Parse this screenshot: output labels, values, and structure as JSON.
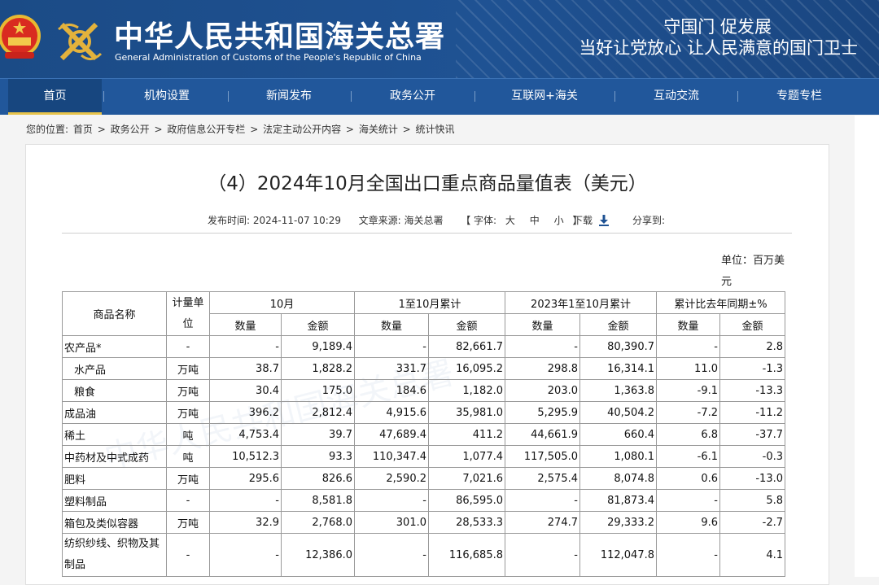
{
  "header": {
    "title_cn": "中华人民共和国海关总署",
    "title_en": "General Administration of Customs of the People's Republic of China",
    "slogan_line1": "守国门  促发展",
    "slogan_line2": "当好让党放心  让人民满意的国门卫士",
    "emblem_icon": "national-emblem-icon",
    "logo_icon": "customs-emblem-icon"
  },
  "nav": {
    "items": [
      {
        "label": "首页"
      },
      {
        "label": "机构设置"
      },
      {
        "label": "新闻发布"
      },
      {
        "label": "政务公开"
      },
      {
        "label": "互联网+海关"
      },
      {
        "label": "互动交流"
      },
      {
        "label": "专题专栏"
      }
    ]
  },
  "breadcrumb": {
    "prefix": "您的位置:",
    "items": [
      "首页",
      "政务公开",
      "政府信息公开专栏",
      "法定主动公开内容",
      "海关统计",
      "统计快讯"
    ],
    "separator": ">"
  },
  "article": {
    "title": "（4）2024年10月全国出口重点商品量值表（美元）",
    "publish_label": "发布时间:",
    "publish_time": "2024-11-07 10:29",
    "source_label": "文章来源:",
    "source": "海关总署",
    "font_open": "【 字体:",
    "font_large": "大",
    "font_medium": "中",
    "font_small": "小",
    "font_close": "】",
    "download_label": "下载",
    "share_label": "分享到:",
    "unit_text": "单位：百万美元"
  },
  "table": {
    "headers": {
      "name": "商品名称",
      "unit": "计量单位",
      "group1": "10月",
      "group2": "1至10月累计",
      "group3": "2023年1至10月累计",
      "group4": "累计比去年同期±%",
      "qty": "数量",
      "amt": "金额"
    },
    "rows": [
      {
        "name": "农产品*",
        "indent": false,
        "unit": "-",
        "c1": "-",
        "c2": "9,189.4",
        "c3": "-",
        "c4": "82,661.7",
        "c5": "-",
        "c6": "80,390.7",
        "c7": "-",
        "c8": "2.8"
      },
      {
        "name": "水产品",
        "indent": true,
        "unit": "万吨",
        "c1": "38.7",
        "c2": "1,828.2",
        "c3": "331.7",
        "c4": "16,095.2",
        "c5": "298.8",
        "c6": "16,314.1",
        "c7": "11.0",
        "c8": "-1.3"
      },
      {
        "name": "粮食",
        "indent": true,
        "unit": "万吨",
        "c1": "30.4",
        "c2": "175.0",
        "c3": "184.6",
        "c4": "1,182.0",
        "c5": "203.0",
        "c6": "1,363.8",
        "c7": "-9.1",
        "c8": "-13.3"
      },
      {
        "name": "成品油",
        "indent": false,
        "unit": "万吨",
        "c1": "396.2",
        "c2": "2,812.4",
        "c3": "4,915.6",
        "c4": "35,981.0",
        "c5": "5,295.9",
        "c6": "40,504.2",
        "c7": "-7.2",
        "c8": "-11.2"
      },
      {
        "name": "稀土",
        "indent": false,
        "unit": "吨",
        "c1": "4,753.4",
        "c2": "39.7",
        "c3": "47,689.4",
        "c4": "411.2",
        "c5": "44,661.9",
        "c6": "660.4",
        "c7": "6.8",
        "c8": "-37.7"
      },
      {
        "name": "中药材及中式成药",
        "indent": false,
        "unit": "吨",
        "c1": "10,512.3",
        "c2": "93.3",
        "c3": "110,347.4",
        "c4": "1,077.4",
        "c5": "117,505.0",
        "c6": "1,080.1",
        "c7": "-6.1",
        "c8": "-0.3"
      },
      {
        "name": "肥料",
        "indent": false,
        "unit": "万吨",
        "c1": "295.6",
        "c2": "826.6",
        "c3": "2,590.2",
        "c4": "7,021.6",
        "c5": "2,575.4",
        "c6": "8,074.8",
        "c7": "0.6",
        "c8": "-13.0"
      },
      {
        "name": "塑料制品",
        "indent": false,
        "unit": "-",
        "c1": "-",
        "c2": "8,581.8",
        "c3": "-",
        "c4": "86,595.0",
        "c5": "-",
        "c6": "81,873.4",
        "c7": "-",
        "c8": "5.8"
      },
      {
        "name": "箱包及类似容器",
        "indent": false,
        "unit": "万吨",
        "c1": "32.9",
        "c2": "2,768.0",
        "c3": "301.0",
        "c4": "28,533.3",
        "c5": "274.7",
        "c6": "29,333.2",
        "c7": "9.6",
        "c8": "-2.7"
      },
      {
        "name": "纺织纱线、织物及其制品",
        "indent": false,
        "unit": "-",
        "c1": "-",
        "c2": "12,386.0",
        "c3": "-",
        "c4": "116,685.8",
        "c5": "-",
        "c6": "112,047.8",
        "c7": "-",
        "c8": "4.1"
      }
    ]
  }
}
